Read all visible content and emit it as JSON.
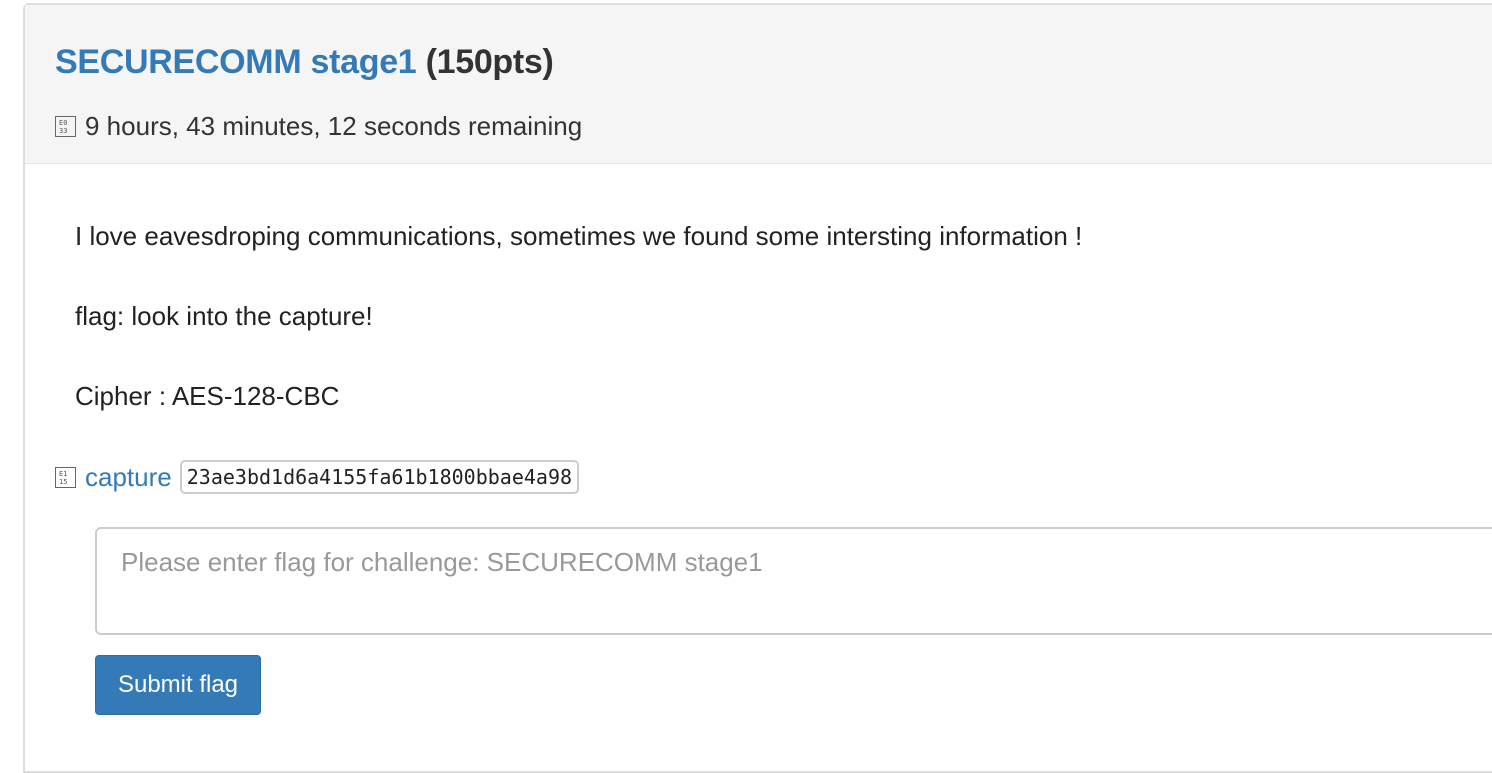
{
  "challenge": {
    "title_link": "SECURECOMM stage1",
    "title_points": "(150pts)",
    "time_remaining": "9 hours, 43 minutes, 12 seconds remaining",
    "description": [
      "I love eavesdroping communications, sometimes we found some intersting information !",
      "flag: look into the capture!",
      "Cipher : AES-128-CBC"
    ]
  },
  "attachment": {
    "icon": "file-icon",
    "name": "capture",
    "hash": "23ae3bd1d6a4155fa61b1800bbae4a98"
  },
  "flag_form": {
    "placeholder": "Please enter flag for challenge: SECURECOMM stage1",
    "value": "",
    "submit_label": "Submit flag"
  },
  "colors": {
    "link": "#337ab7",
    "button_bg": "#337ab7",
    "heading_bg": "#f5f5f5"
  }
}
